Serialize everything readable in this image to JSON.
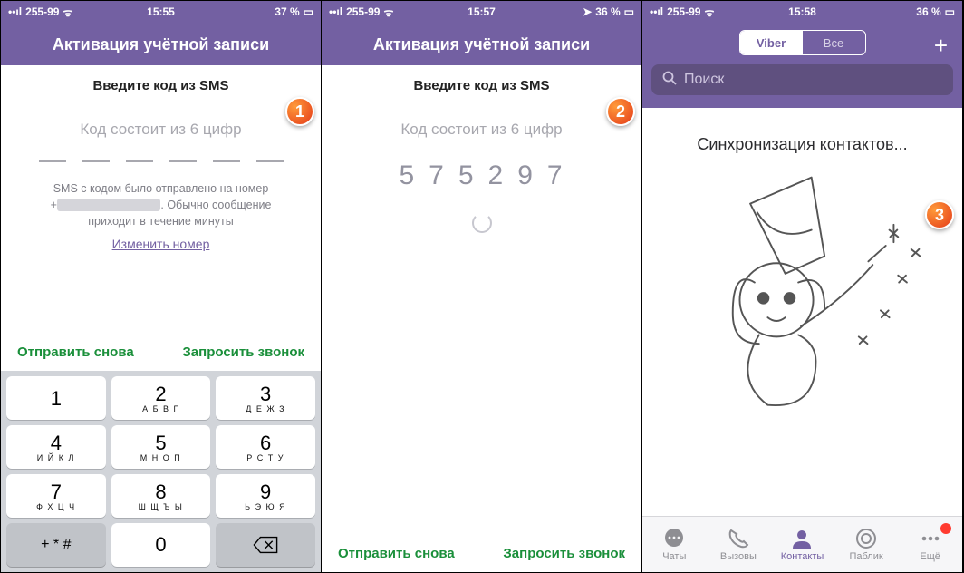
{
  "markers": {
    "one": "1",
    "two": "2",
    "three": "3"
  },
  "status": {
    "s1": {
      "carrier": "255-99",
      "time": "15:55",
      "battery": "37 %"
    },
    "s2": {
      "carrier": "255-99",
      "time": "15:57",
      "battery": "36 %"
    },
    "s3": {
      "carrier": "255-99",
      "time": "15:58",
      "battery": "36 %"
    }
  },
  "screen1": {
    "title": "Активация учётной записи",
    "subtitle": "Введите код из SMS",
    "hint": "Код состоит из 6 цифр",
    "sent_prefix": "SMS с кодом было отправлено на номер",
    "sent_suffix": ". Обычно сообщение приходит в течение минуты",
    "change": "Изменить номер",
    "resend": "Отправить снова",
    "request_call": "Запросить звонок"
  },
  "screen2": {
    "title": "Активация учётной записи",
    "subtitle": "Введите код из SMS",
    "hint": "Код состоит из 6 цифр",
    "code": [
      "5",
      "7",
      "5",
      "2",
      "9",
      "7"
    ],
    "resend": "Отправить снова",
    "request_call": "Запросить звонок"
  },
  "screen3": {
    "seg_a": "Viber",
    "seg_b": "Все",
    "search_placeholder": "Поиск",
    "sync": "Синхронизация контактов...",
    "tabs": {
      "chats": "Чаты",
      "calls": "Вызовы",
      "contacts": "Контакты",
      "public": "Паблик",
      "more": "Ещё"
    }
  },
  "keypad": {
    "k1": {
      "d": "1",
      "s": ""
    },
    "k2": {
      "d": "2",
      "s": "А Б В Г"
    },
    "k3": {
      "d": "3",
      "s": "Д Е Ж З"
    },
    "k4": {
      "d": "4",
      "s": "И Й К Л"
    },
    "k5": {
      "d": "5",
      "s": "М Н О П"
    },
    "k6": {
      "d": "6",
      "s": "Р С Т У"
    },
    "k7": {
      "d": "7",
      "s": "Ф Х Ц Ч"
    },
    "k8": {
      "d": "8",
      "s": "Ш Щ Ъ Ы"
    },
    "k9": {
      "d": "9",
      "s": "Ь Э Ю Я"
    },
    "ksym": "+ * #",
    "k0": {
      "d": "0",
      "s": ""
    }
  }
}
